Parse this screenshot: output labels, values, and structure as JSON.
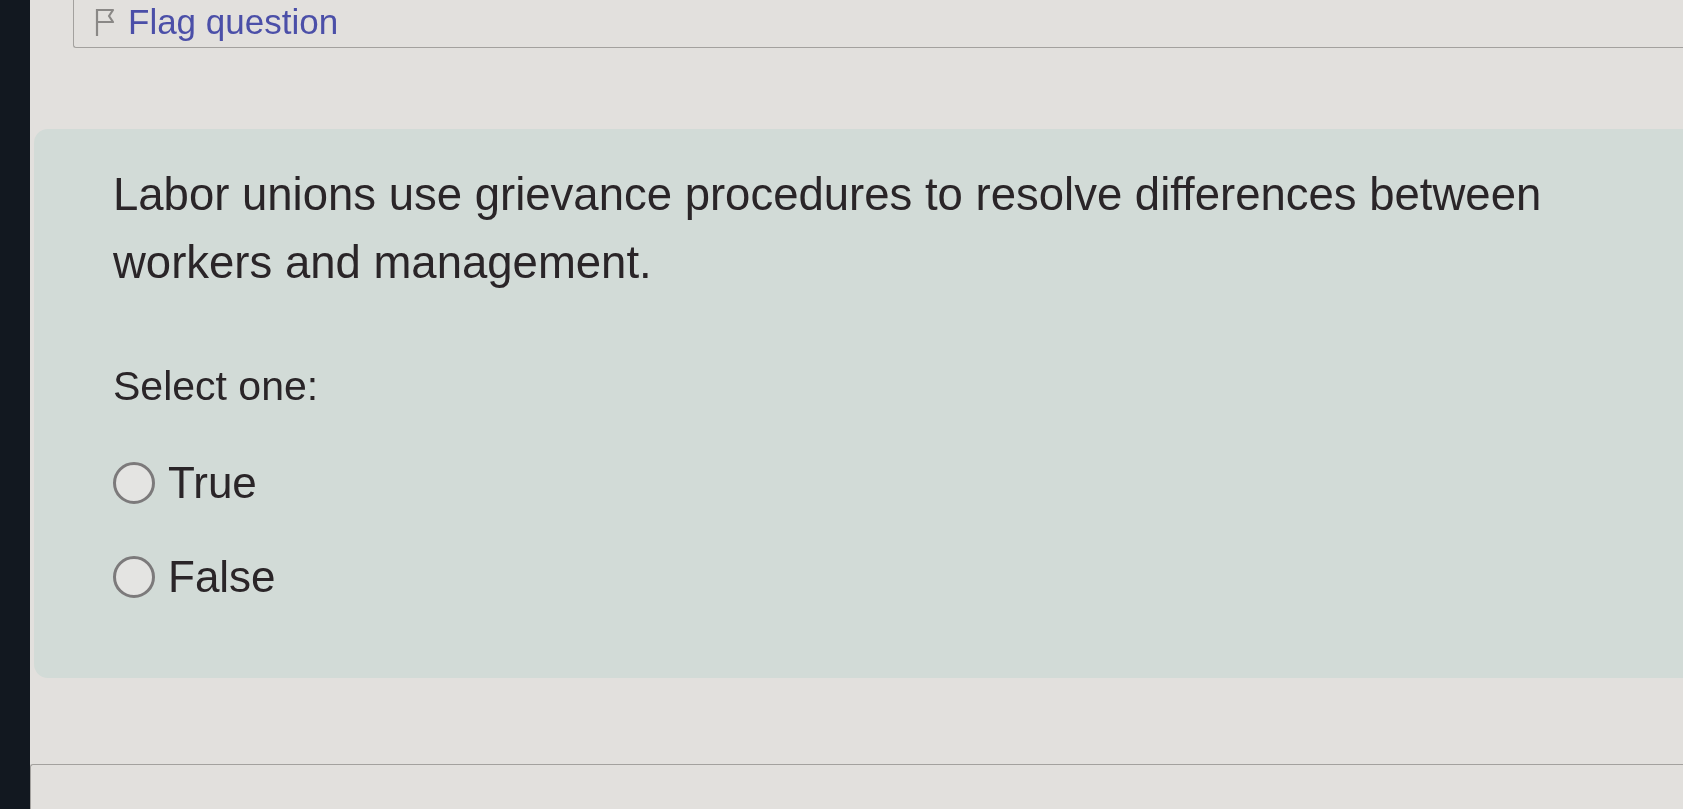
{
  "flag": {
    "label": "Flag question"
  },
  "question": {
    "text": "Labor unions use grievance procedures to resolve differences between workers and management.",
    "prompt": "Select one:",
    "options": [
      {
        "label": "True",
        "selected": false
      },
      {
        "label": "False",
        "selected": false
      }
    ]
  }
}
